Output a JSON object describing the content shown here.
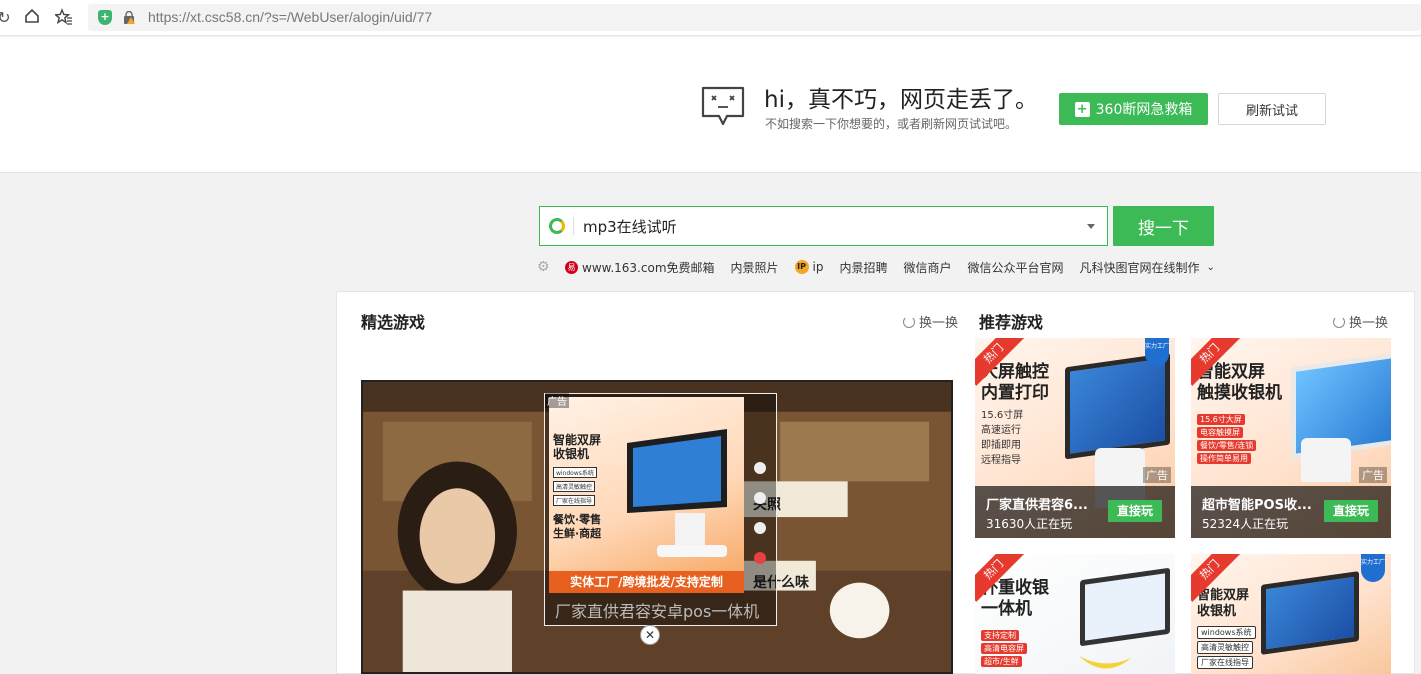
{
  "browser": {
    "url": "https://xt.csc58.cn/?s=/WebUser/alogin/uid/77"
  },
  "error": {
    "title": "hi，真不巧，网页走丢了。",
    "subtitle": "不如搜索一下你想要的，或者刷新网页试试吧。",
    "rescue_label": "360断网急救箱",
    "refresh_label": "刷新试试"
  },
  "search": {
    "value": "mp3在线试听",
    "button_label": "搜一下"
  },
  "quick_links": [
    {
      "label": "www.163.com免费邮箱",
      "icon": "netease-icon"
    },
    {
      "label": "内景照片"
    },
    {
      "label": "ip",
      "icon": "ip-icon"
    },
    {
      "label": "内景招聘"
    },
    {
      "label": "微信商户"
    },
    {
      "label": "微信公众平台官网"
    },
    {
      "label": "凡科快图官网在线制作"
    }
  ],
  "featured": {
    "title": "精选游戏",
    "refresh_label": "换一换",
    "game_text_1": "关照",
    "game_text_2": "是什么味",
    "ad": {
      "label": "广告",
      "img_title": "智能双屏收银机",
      "img_tags": [
        "windows系统",
        "高清灵敏触控",
        "厂家在线指导"
      ],
      "img_tag2": "餐饮·零售\n生鲜·商超",
      "img_bar": "实体工厂/跨境批发/支持定制",
      "caption": "厂家直供君容安卓pos一体机",
      "active_dot": 4,
      "dot_count": 4
    }
  },
  "recommend": {
    "title": "推荐游戏",
    "refresh_label": "换一换",
    "cards": [
      {
        "hot": "热门",
        "art_title": "大屏触控\n内置打印",
        "art_sub": "15.6寸屏\n高速运行\n即插即用\n远程指导",
        "badge": "实力工厂",
        "ad_tag": "广告",
        "info_title": "厂家直供君容6...",
        "players": "31630人正在玩",
        "play_label": "直接玩"
      },
      {
        "hot": "热门",
        "art_title": "智能双屏\n触摸收银机",
        "art_tags": [
          "15.6寸大屏",
          "电容触摸屏",
          "餐饮/零售/连锁",
          "操作简单易用"
        ],
        "ad_tag": "广告",
        "info_title": "超市智能POS收...",
        "players": "52324人正在玩",
        "play_label": "直接玩"
      },
      {
        "hot": "热门",
        "art_title": "杯重收银\n一体机",
        "art_tags": [
          "支持定制",
          "高清电容屏",
          "超市/生鲜"
        ]
      },
      {
        "hot": "热门",
        "art_title": "智能双屏\n收银机",
        "art_tags": [
          "windows系统",
          "高清灵敏触控",
          "厂家在线指导"
        ],
        "badge": "实力工厂"
      }
    ]
  }
}
